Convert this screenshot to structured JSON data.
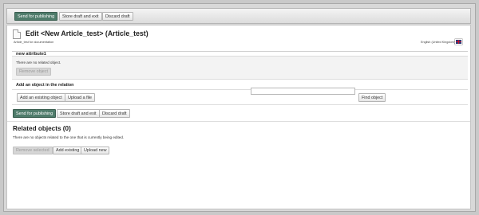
{
  "top_toolbar": {
    "send_label": "Send for publishing",
    "store_label": "Store draft and exit",
    "discard_label": "Discard draft"
  },
  "header": {
    "title": "Edit <New Article_test> (Article_test)",
    "subtitle": "Article_test for documentation",
    "language": "English (United Kingdom)"
  },
  "attribute_group": {
    "title": "new attribute1",
    "no_related_text": "There are no related object.",
    "remove_label": "Remove object",
    "add_section_label": "Add an object in the relation",
    "add_existing_label": "Add an existing object",
    "upload_label": "Upload a file",
    "search_value": "",
    "find_label": "Find object"
  },
  "bottom_toolbar": {
    "send_label": "Send for publishing",
    "store_label": "Store draft and exit",
    "discard_label": "Discard draft"
  },
  "related": {
    "title": "Related objects (0)",
    "empty_text": "There are no objects related to the one that is currently being edited.",
    "remove_selected_label": "Remove selected",
    "add_existing_label": "Add existing",
    "upload_new_label": "Upload new"
  },
  "colors": {
    "primary_button": "#4f7c6b",
    "disabled_button": "#d6d6d6"
  },
  "icons": {
    "document": "document-icon",
    "flag": "uk-flag-icon"
  }
}
